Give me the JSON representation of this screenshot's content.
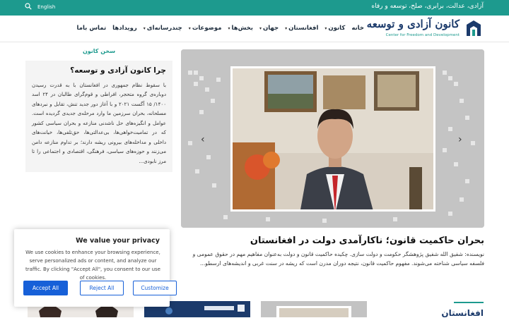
{
  "topbar": {
    "tagline": "آزادی، عدالت، برابری، صلح، توسعه و رفاه",
    "language": "English"
  },
  "logo": {
    "name_fa": "کانون آزادی و توسعه",
    "name_en": "Center for Freedom and Development"
  },
  "menu": [
    {
      "label": "خانه",
      "dropdown": false
    },
    {
      "label": "کانون",
      "dropdown": true
    },
    {
      "label": "افغانستان",
      "dropdown": true
    },
    {
      "label": "جهان",
      "dropdown": true
    },
    {
      "label": "بخش‌ها",
      "dropdown": true
    },
    {
      "label": "موضوعات",
      "dropdown": true
    },
    {
      "label": "چندرسانه‌ای",
      "dropdown": true
    },
    {
      "label": "رویدادها",
      "dropdown": false
    },
    {
      "label": "تماس باما",
      "dropdown": false
    }
  ],
  "featured": {
    "headline": "بحران حاکمیت قانون؛ ناکارآمدی دولت در افغانستان",
    "summary": "نویسنده: شفیق الله شفیق پژوهشگر حکومت و دولت سازی. چکیده حاکمیت قانون و دولت به‌عنوان مفاهیم مهم در حقوق عمومی و فلسفه سیاسی شناخته می‌شوند. مفهوم حاکمیت قانون، نتیجه دوران مدرن است که ریشه در سنت غربی و اندیشه‌های ارسطو..."
  },
  "sidebar": {
    "section_title": "سخن کانون",
    "card_title": "چرا کانون آزادی و توسعه؟",
    "card_text": "با سقوط نظام جمهوری در افغانستان با به قدرت رسیدن دوباره‌ی گروه متحجر، افراطی و قوم‌گرای طالبان در ۲۴ اسد ۱۴۰۰/ ۱۵ آگست ۲۰۲۱ و با آغاز دور جدید تنش، تقابل و نبردهای مسلحانه، بحران سرزمین ما وارد مرحله‌ی جدیدی گردیده است. عوامل و انگیزه‌های حل ناشدنی منازعه و بحران سیاسی کشور که در تمامیت‌خواهی‌ها، بی‌عدالتی‌ها، حق‌تلفی‌ها، خیانت‌های داخلی و مداخله‌های بیرونی ریشه دارند؛ بر تداوم منازعه دامن می‌زنند و حوزه‌های سیاسی، فرهنگی، اقتصادی و اجتماعی را تا مرز نابودی..."
  },
  "cookie": {
    "title": "We value your privacy",
    "text": "We use cookies to enhance your browsing experience, serve personalized ads or content, and analyze our traffic. By clicking \"Accept All\", you consent to our use of cookies.",
    "accept": "Accept All",
    "reject": "Reject All",
    "customize": "Customize"
  },
  "bottom": {
    "section_title": "افغانستان"
  },
  "colors": {
    "teal": "#1d9a8e",
    "navy": "#1b3a6b",
    "button_blue": "#1760d8"
  }
}
